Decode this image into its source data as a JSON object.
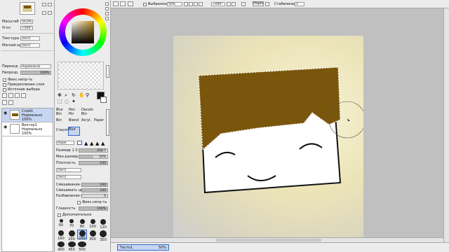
{
  "navigator": {
    "zoom_label": "Масштаб",
    "zoom_value": "50,0%",
    "angle_label": "Угол",
    "angle_value": "+000°"
  },
  "texture": {
    "label": "Текстура",
    "value": "[Нет]",
    "edge_label": "Мягкий край",
    "edge_value": "[Нет]"
  },
  "layer_props": {
    "mode_label": "Переход",
    "mode_value": "Нормально",
    "opacity_label": "Непрозр.",
    "opacity_value": "100%",
    "check1": "Фикс.непр-ть",
    "check2": "Прикрепление слоя",
    "check3": "Источник выбора"
  },
  "layers": [
    {
      "name": "Слой1",
      "mode": "Нормально",
      "opacity": "100%"
    },
    {
      "name": "Вектор1",
      "mode": "Нормально",
      "opacity": "100%"
    }
  ],
  "tools": [
    [
      "Blur",
      "Pen",
      "Decals"
    ],
    [
      "Bin",
      "Pin",
      "Bin"
    ],
    [
      "Bin",
      "Blend",
      "Acryl.",
      "Paper"
    ],
    [
      "Crayon",
      "Blur"
    ]
  ],
  "brush": {
    "mode": "Норм",
    "size_label": "Размер",
    "size_mult": "x 1.0",
    "size_value": "250.0",
    "min_label": "Мин размер",
    "min_value": "50%",
    "density_label": "Плотность",
    "density_value": "100",
    "tex1": "[Нет]",
    "tex2": "[Нет]",
    "blend_label": "Смешивание цвет",
    "blend_value": "100",
    "dilute_label": "Смешивать цвет",
    "dilute_value": "100",
    "persist_label": "Разбавление цвет",
    "persist_value": "0",
    "fix_label": "Фикс.непр-ть",
    "hard_label": "Гладкость",
    "hard_value": "100%",
    "extra_label": "Дополнительно"
  },
  "brush_sizes": [
    "60",
    "70",
    "80",
    "100",
    "120",
    "160",
    "200",
    "250",
    "300",
    "350",
    "400",
    "450",
    "500"
  ],
  "toolbar": {
    "zoom": "50%",
    "angle": "+000°",
    "reset": "Норм",
    "stab_label": "Стабилизация",
    "stab_value": "1",
    "check_label": "Выбранное"
  },
  "status": {
    "doc_name": "Тесто1",
    "doc_zoom": "50%"
  },
  "colors": {
    "accent": "#316ac5",
    "hair": "#7a560c",
    "canvas_bg": "#f1ecc8"
  }
}
